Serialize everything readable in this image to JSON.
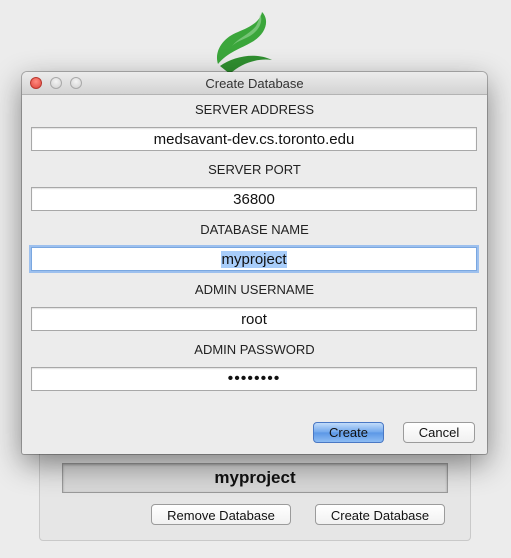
{
  "background": {
    "database_name": "myproject",
    "remove_button": "Remove Database",
    "create_button": "Create Database"
  },
  "dialog": {
    "title": "Create Database",
    "fields": [
      {
        "label": "SERVER ADDRESS",
        "value": "medsavant-dev.cs.toronto.edu"
      },
      {
        "label": "SERVER PORT",
        "value": "36800"
      },
      {
        "label": "DATABASE NAME",
        "value": "myproject"
      },
      {
        "label": "ADMIN USERNAME",
        "value": "root"
      },
      {
        "label": "ADMIN PASSWORD",
        "value": "••••••••"
      }
    ],
    "create_button": "Create",
    "cancel_button": "Cancel"
  },
  "colors": {
    "accent": "#5b97e6",
    "selection": "#a8cdfa",
    "logo_green": "#3ba63b"
  },
  "icons": [
    "app-logo-icon",
    "close-window-icon",
    "minimize-window-icon",
    "zoom-window-icon"
  ]
}
